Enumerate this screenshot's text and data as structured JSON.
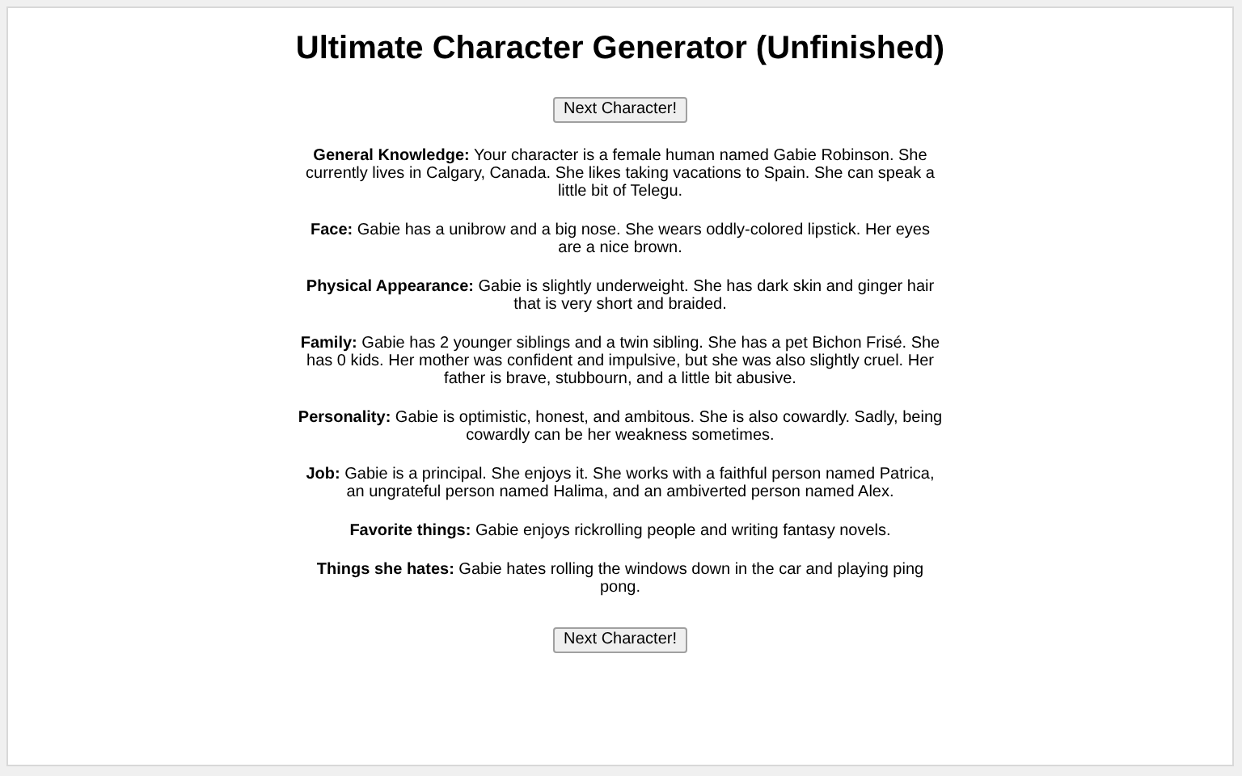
{
  "title": "Ultimate Character Generator (Unfinished)",
  "buttons": [
    "Next Character!",
    "Next Character!"
  ],
  "sections": [
    {
      "text": "**General Knowledge:** Your character is a female human named Gabie Robinson. She currently lives in Calgary, Canada. She likes taking vacations to Spain. She can speak a little bit of Telegu."
    },
    {
      "text": "**Face:** Gabie has a unibrow and a big nose. She wears oddly-colored lipstick. Her eyes are a nice brown."
    },
    {
      "text": "**Physical Appearance:** Gabie is slightly underweight. She has dark skin and ginger hair that is very short and braided."
    },
    {
      "text": "**Family:** Gabie has 2 younger siblings and a twin sibling. She has a pet Bichon Frisé. She has 0 kids. Her mother was confident and impulsive, but she was also slightly cruel. Her father is brave, stubbourn, and a little bit abusive."
    },
    {
      "text": "**Personality:** Gabie is optimistic, honest, and ambitous. She is also cowardly. Sadly, being cowardly can be her weakness sometimes."
    },
    {
      "text": "**Job:** Gabie is a principal. She enjoys it. She works with a faithful person named Patrica, an ungrateful person named Halima, and an ambiverted person named Alex."
    },
    {
      "text": "**Favorite things:** Gabie enjoys rickrolling people and writing fantasy novels."
    },
    {
      "text": "**Things she hates:** Gabie hates rolling the windows down in the car and playing ping pong."
    }
  ]
}
